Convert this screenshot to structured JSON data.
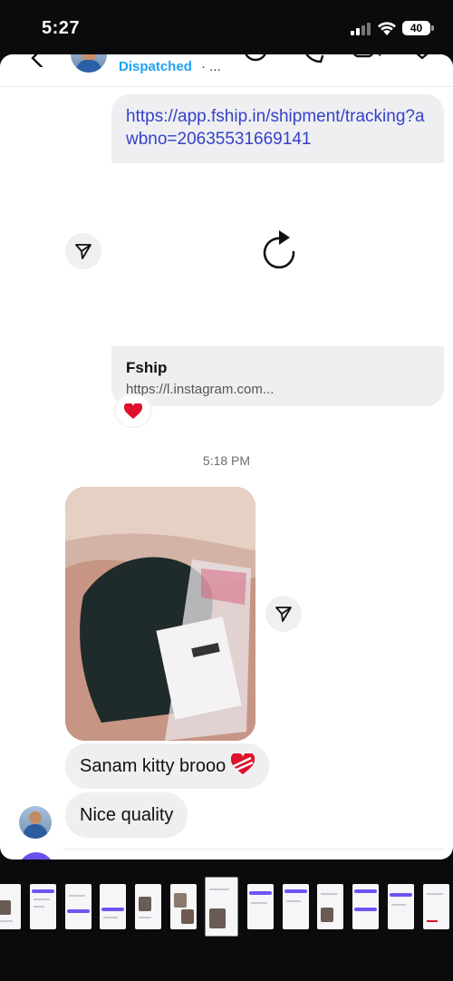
{
  "status_bar": {
    "time": "5:27",
    "battery": "40"
  },
  "header": {
    "status": "Dispatched",
    "separator": "· ..."
  },
  "messages": {
    "link_url": "https://app.fship.in/shipment/tracking?awbno=20635531669141",
    "link_card_title": "Fship",
    "link_card_domain": "https://l.instagram.com...",
    "reaction": "heart",
    "timestamp": "5:18 PM",
    "msg1": "Sanam kitty brooo",
    "msg1_emoji": "heart-with-ribbon",
    "msg2": "Nice quality"
  },
  "colors": {
    "accent": "#1da1f2",
    "link": "#3442c9",
    "bubble": "#efeff2",
    "composer_camera": "#6b4ff0"
  },
  "icons": [
    "back-icon",
    "sticker-icon",
    "phone-icon",
    "video-icon",
    "heart-icon",
    "reload-icon",
    "share-icon",
    "heart-reaction-icon",
    "camera-icon"
  ]
}
